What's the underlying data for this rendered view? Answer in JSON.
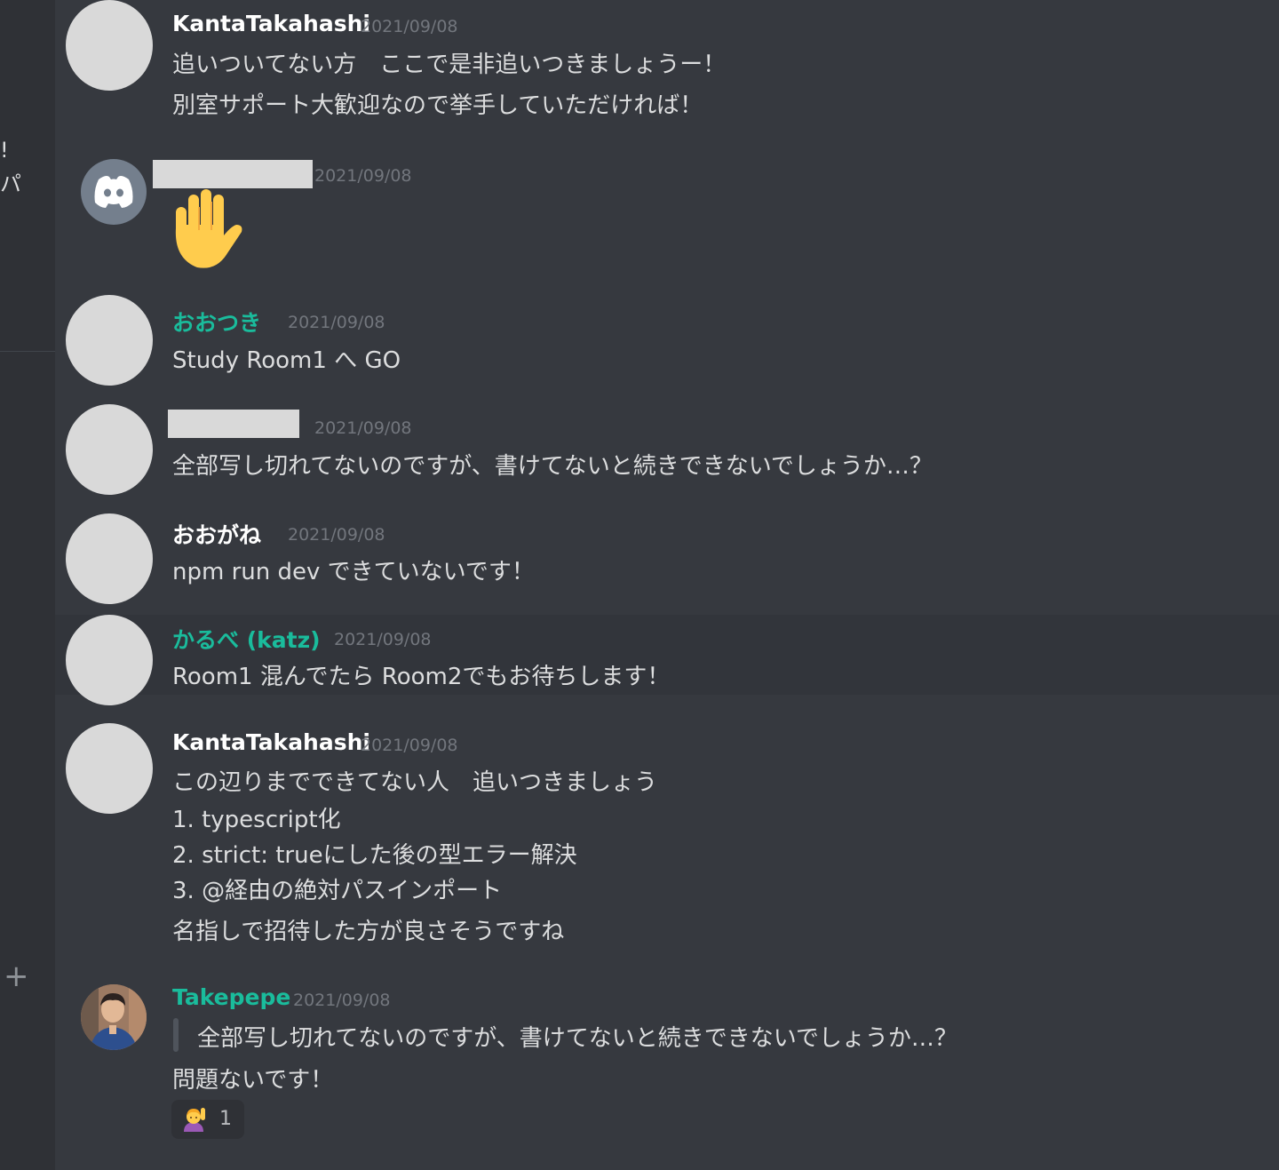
{
  "sidebar": {
    "fragment_1": "!",
    "fragment_2": "パ",
    "add_glyph": "+"
  },
  "messages": [
    {
      "author": "KantaTakahashi",
      "timestamp": "2021/09/08",
      "lines": [
        "追いついてない方　ここで是非追いつきましょうー！",
        "別室サポート大歓迎なので挙手していただければ！"
      ]
    },
    {
      "author_redacted": true,
      "avatar": "discord-logo-icon",
      "timestamp": "2021/09/08",
      "emoji": "raised-hand-icon"
    },
    {
      "author": "おおつき",
      "author_color": "#1abc9c",
      "timestamp": "2021/09/08",
      "lines": [
        "Study Room1 へ GO"
      ]
    },
    {
      "author_redacted": true,
      "timestamp": "2021/09/08",
      "lines": [
        "全部写し切れてないのですが、書けてないと続きできないでしょうか…？"
      ]
    },
    {
      "author": "おおがね",
      "timestamp": "2021/09/08",
      "lines": [
        "npm run dev できていないです！"
      ]
    },
    {
      "author": "かるべ (katz)",
      "author_color": "#1abc9c",
      "timestamp": "2021/09/08",
      "lines": [
        "Room1 混んでたら Room2でもお待ちします！"
      ]
    },
    {
      "author": "KantaTakahashi",
      "timestamp": "2021/09/08",
      "lines": [
        "この辺りまでできてない人　追いつきましょう",
        "1. typescript化",
        "2. strict: trueにした後の型エラー解決",
        " 3. @経由の絶対パスインポート",
        "名指しで招待した方が良さそうですね"
      ]
    },
    {
      "author": "Takepepe",
      "author_color": "#1abc9c",
      "timestamp": "2021/09/08",
      "quote": "全部写し切れてないのですが、書けてないと続きできないでしょうか…？",
      "lines": [
        "問題ないです！"
      ],
      "reaction": {
        "emoji": "person-raising-hand-icon",
        "count": "1"
      }
    }
  ],
  "colors": {
    "background": "#36393f",
    "sidebar": "#2f3136",
    "text": "#dcddde",
    "timestamp": "#72767d",
    "role_green": "#1abc9c"
  }
}
